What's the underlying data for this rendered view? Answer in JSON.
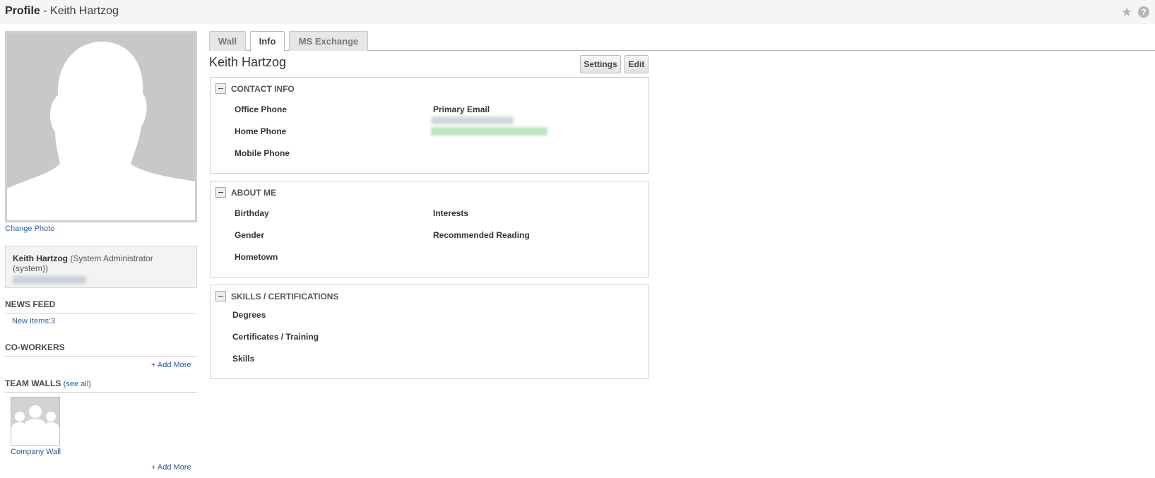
{
  "header": {
    "title_prefix": "Profile",
    "title_separator": " - ",
    "title_name": "Keith Hartzog",
    "star_icon": "star-icon",
    "help_icon": "help-icon",
    "help_glyph": "?"
  },
  "sidebar": {
    "change_photo": "Change Photo",
    "user_name": "Keith Hartzog",
    "user_role": "(System Administrator (system))",
    "news_feed": {
      "title": "NEWS FEED",
      "link": "New Items:3"
    },
    "coworkers": {
      "title": "CO-WORKERS",
      "add_more": "+ Add More"
    },
    "team_walls": {
      "title": "TEAM WALLS",
      "see_all": "(see all)",
      "wall_name": "Company Wall",
      "add_more": "+ Add More"
    }
  },
  "tabs": [
    {
      "label": "Wall",
      "active": false
    },
    {
      "label": "Info",
      "active": true
    },
    {
      "label": "MS Exchange",
      "active": false
    }
  ],
  "main": {
    "title": "Keith Hartzog",
    "settings_button": "Settings",
    "edit_button": "Edit",
    "contact_info": {
      "title": "CONTACT INFO",
      "office_phone": "Office Phone",
      "home_phone": "Home Phone",
      "mobile_phone": "Mobile Phone",
      "primary_email": "Primary Email"
    },
    "about_me": {
      "title": "ABOUT ME",
      "birthday": "Birthday",
      "gender": "Gender",
      "hometown": "Hometown",
      "interests": "Interests",
      "recommended_reading": "Recommended Reading"
    },
    "skills": {
      "title": "SKILLS / CERTIFICATIONS",
      "degrees": "Degrees",
      "certificates": "Certificates / Training",
      "skills": "Skills"
    }
  },
  "colors": {
    "accent_link": "#2a5c9a",
    "topbar_bg": "#f4f5f6",
    "active_tab_bg": "#ffffff",
    "inactive_tab_bg": "#e6e6e6"
  }
}
